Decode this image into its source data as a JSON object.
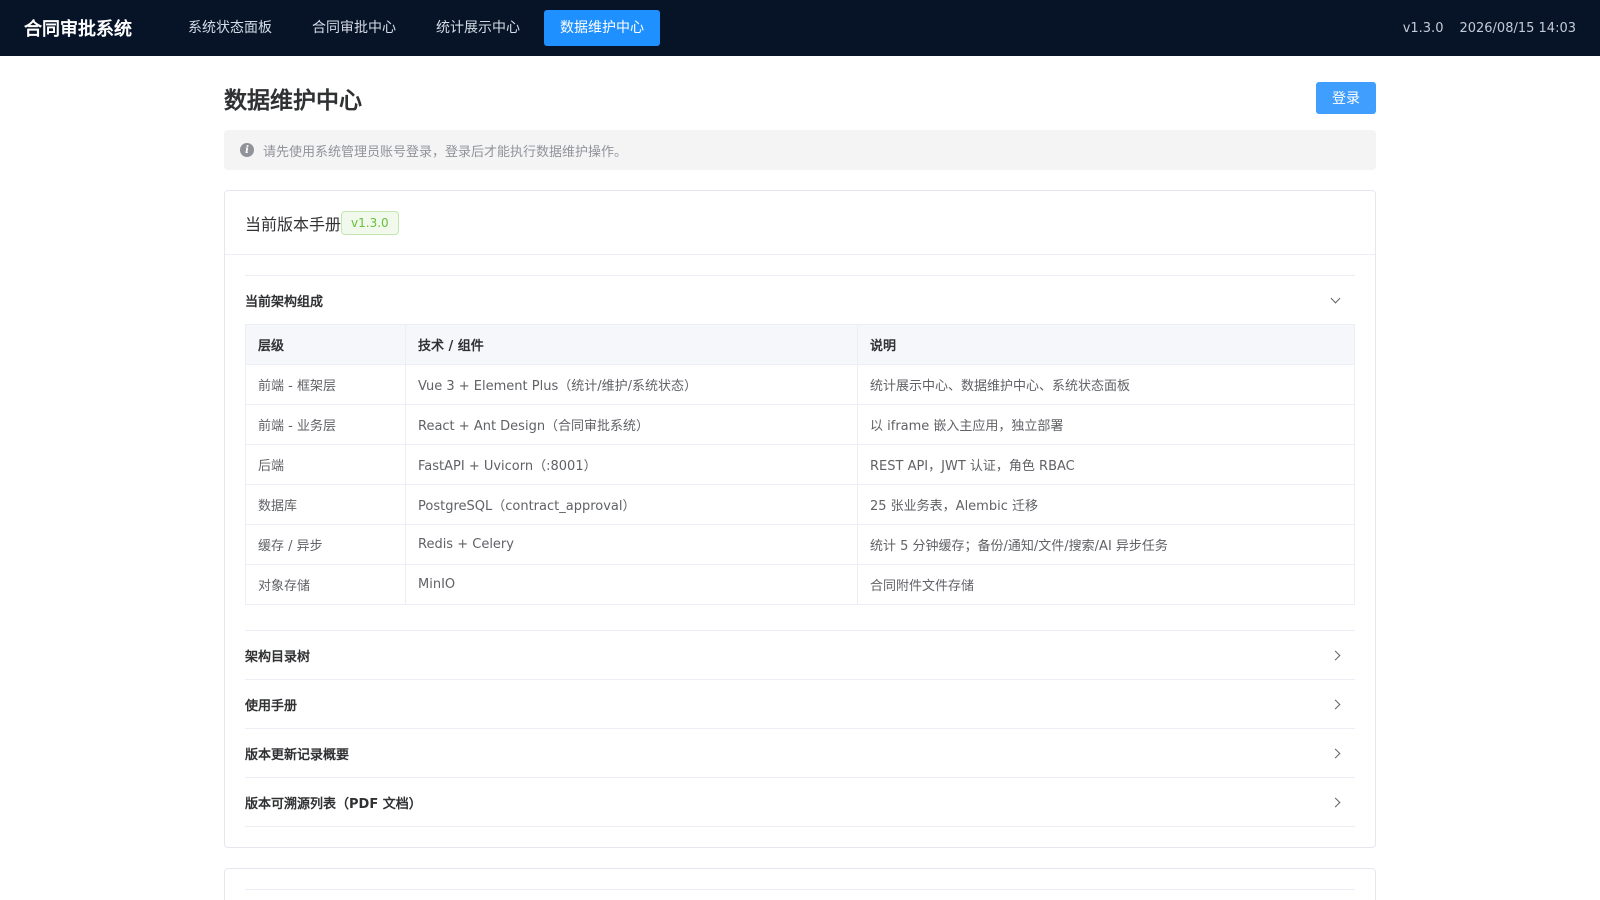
{
  "app": {
    "brand": "合同审批系统",
    "version": "v1.3.0",
    "datetime": "2026/08/15 14:03"
  },
  "nav": {
    "items": [
      {
        "label": "系统状态面板",
        "active": false
      },
      {
        "label": "合同审批中心",
        "active": false
      },
      {
        "label": "统计展示中心",
        "active": false
      },
      {
        "label": "数据维护中心",
        "active": true
      }
    ]
  },
  "page": {
    "title": "数据维护中心",
    "login_label": "登录",
    "notice": "请先使用系统管理员账号登录，登录后才能执行数据维护操作。"
  },
  "manual": {
    "title": "当前版本手册",
    "version_tag": "v1.3.0",
    "sections": [
      {
        "label": "当前架构组成",
        "expanded": true
      },
      {
        "label": "架构目录树",
        "expanded": false
      },
      {
        "label": "使用手册",
        "expanded": false
      },
      {
        "label": "版本更新记录概要",
        "expanded": false
      },
      {
        "label": "版本可溯源列表（PDF 文档）",
        "expanded": false
      }
    ],
    "architecture": {
      "headers": [
        "层级",
        "技术 / 组件",
        "说明"
      ],
      "rows": [
        [
          "前端 - 框架层",
          "Vue 3 + Element Plus（统计/维护/系统状态）",
          "统计展示中心、数据维护中心、系统状态面板"
        ],
        [
          "前端 - 业务层",
          "React + Ant Design（合同审批系统）",
          "以 iframe 嵌入主应用，独立部署"
        ],
        [
          "后端",
          "FastAPI + Uvicorn（:8001）",
          "REST API，JWT 认证，角色 RBAC"
        ],
        [
          "数据库",
          "PostgreSQL（contract_approval）",
          "25 张业务表，Alembic 迁移"
        ],
        [
          "缓存 / 异步",
          "Redis + Celery",
          "统计 5 分钟缓存；备份/通知/文件/搜索/AI 异步任务"
        ],
        [
          "对象存储",
          "MinIO",
          "合同附件文件存储"
        ]
      ]
    }
  },
  "colors": {
    "topbar_bg": "#071428",
    "nav_active": "#1e90ff",
    "primary": "#409eff",
    "tag_green": "#67c23a"
  },
  "icons": {
    "notice": "info-circle-icon",
    "expanded": "chevron-down-icon",
    "collapsed": "chevron-right-icon"
  }
}
